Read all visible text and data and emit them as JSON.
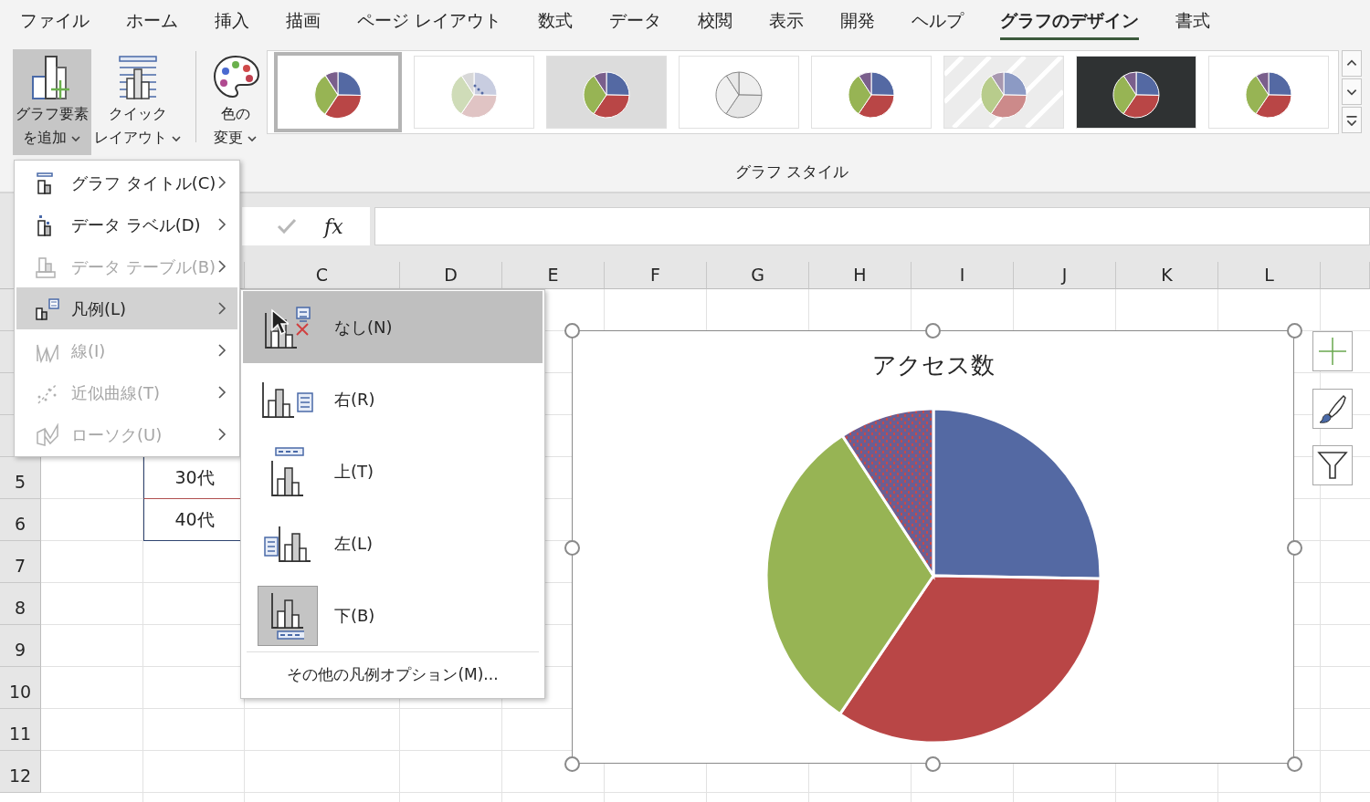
{
  "tabs": [
    {
      "label": "ファイル",
      "selected": false
    },
    {
      "label": "ホーム",
      "selected": false
    },
    {
      "label": "挿入",
      "selected": false
    },
    {
      "label": "描画",
      "selected": false
    },
    {
      "label": "ページ レイアウト",
      "selected": false
    },
    {
      "label": "数式",
      "selected": false
    },
    {
      "label": "データ",
      "selected": false
    },
    {
      "label": "校閲",
      "selected": false
    },
    {
      "label": "表示",
      "selected": false
    },
    {
      "label": "開発",
      "selected": false
    },
    {
      "label": "ヘルプ",
      "selected": false
    },
    {
      "label": "グラフのデザイン",
      "selected": true
    },
    {
      "label": "書式",
      "selected": false
    }
  ],
  "ribbon": {
    "buttons": [
      {
        "kind": "add_element",
        "lines": [
          "グラフ要素",
          "を追加"
        ],
        "pressed": true
      },
      {
        "kind": "quick_layout",
        "lines": [
          "クイック",
          "レイアウト"
        ],
        "pressed": false
      },
      {
        "kind": "colors",
        "lines": [
          "色の",
          "変更"
        ],
        "pressed": false
      }
    ],
    "styles": [
      {
        "kind": "plain",
        "selected": true
      },
      {
        "kind": "dotted",
        "selected": false
      },
      {
        "kind": "gradient",
        "selected": false
      },
      {
        "kind": "outline",
        "selected": false
      },
      {
        "kind": "plain",
        "selected": false
      },
      {
        "kind": "striped",
        "selected": false
      },
      {
        "kind": "dark",
        "selected": false
      },
      {
        "kind": "plain",
        "selected": false
      }
    ],
    "group_label": "グラフ スタイル"
  },
  "formula_bar": {
    "function_label": "fx"
  },
  "sheet": {
    "columns": [
      "C",
      "D",
      "E",
      "F",
      "G",
      "H",
      "I",
      "J",
      "K",
      "L"
    ],
    "rows": [
      {
        "number": "5",
        "column_b": "30代"
      },
      {
        "number": "6",
        "column_b": "40代"
      },
      {
        "number": "7"
      },
      {
        "number": "8"
      },
      {
        "number": "9"
      },
      {
        "number": "10"
      },
      {
        "number": "11"
      },
      {
        "number": "12"
      }
    ]
  },
  "menu": {
    "items": [
      {
        "kind": "title",
        "label": "グラフ タイトル(C)",
        "disabled": false,
        "highlighted": false
      },
      {
        "kind": "data_label",
        "label": "データ ラベル(D)",
        "disabled": false,
        "highlighted": false
      },
      {
        "kind": "data_table",
        "label": "データ テーブル(B)",
        "disabled": true,
        "highlighted": false
      },
      {
        "kind": "legend",
        "label": "凡例(L)",
        "disabled": false,
        "highlighted": true
      },
      {
        "kind": "lines",
        "label": "線(I)",
        "disabled": true,
        "highlighted": false
      },
      {
        "kind": "trendline",
        "label": "近似曲線(T)",
        "disabled": true,
        "highlighted": false
      },
      {
        "kind": "candlestick",
        "label": "ローソク(U)",
        "disabled": true,
        "highlighted": false
      }
    ]
  },
  "submenu": {
    "items": [
      {
        "kind": "none",
        "label": "なし(N)",
        "highlighted": true,
        "selected": false
      },
      {
        "kind": "right",
        "label": "右(R)",
        "highlighted": false,
        "selected": false
      },
      {
        "kind": "top",
        "label": "上(T)",
        "highlighted": false,
        "selected": false
      },
      {
        "kind": "left",
        "label": "左(L)",
        "highlighted": false,
        "selected": false
      },
      {
        "kind": "bottom",
        "label": "下(B)",
        "highlighted": false,
        "selected": true
      }
    ],
    "footer": "その他の凡例オプション(M)..."
  },
  "chart": {
    "title": "アクセス数"
  }
}
